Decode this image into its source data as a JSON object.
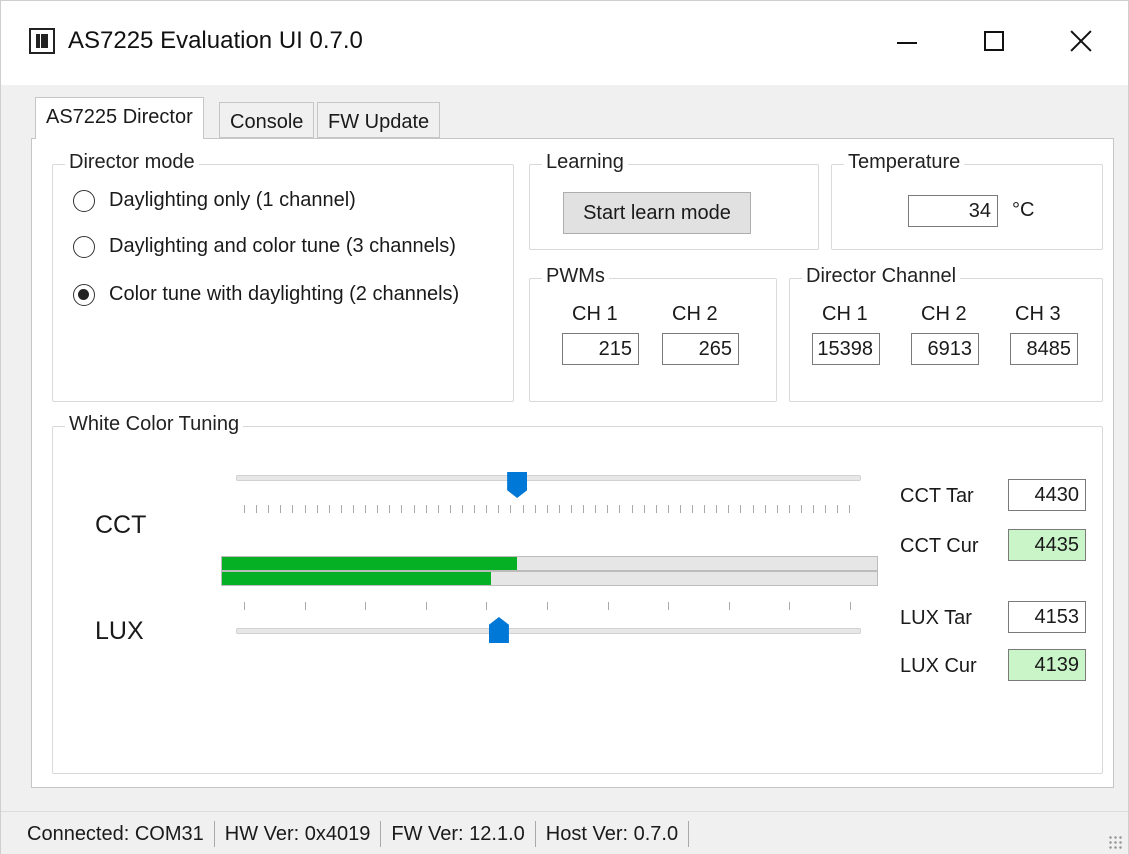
{
  "window": {
    "title": "AS7225 Evaluation UI 0.7.0"
  },
  "tabs": [
    {
      "label": "AS7225 Director",
      "active": true
    },
    {
      "label": "Console",
      "active": false
    },
    {
      "label": "FW Update",
      "active": false
    }
  ],
  "director_mode": {
    "title": "Director mode",
    "options": [
      {
        "label": "Daylighting only (1 channel)",
        "checked": false
      },
      {
        "label": "Daylighting and color tune (3 channels)",
        "checked": false
      },
      {
        "label": "Color tune with daylighting (2 channels)",
        "checked": true
      }
    ]
  },
  "learning": {
    "title": "Learning",
    "button_label": "Start learn mode"
  },
  "temperature": {
    "title": "Temperature",
    "value": "34",
    "unit": "°C"
  },
  "pwms": {
    "title": "PWMs",
    "channels": [
      {
        "label": "CH 1",
        "value": "215"
      },
      {
        "label": "CH 2",
        "value": "265"
      }
    ]
  },
  "director_channel": {
    "title": "Director Channel",
    "channels": [
      {
        "label": "CH 1",
        "value": "15398"
      },
      {
        "label": "CH 2",
        "value": "6913"
      },
      {
        "label": "CH 3",
        "value": "8485"
      }
    ]
  },
  "white_color_tuning": {
    "title": "White Color Tuning",
    "cct": {
      "label": "CCT",
      "slider_fraction": 0.45,
      "progress_fraction": 0.45
    },
    "lux": {
      "label": "LUX",
      "slider_fraction": 0.42,
      "progress_fraction": 0.41
    },
    "readouts": {
      "cct_tar_label": "CCT Tar",
      "cct_tar_value": "4430",
      "cct_cur_label": "CCT Cur",
      "cct_cur_value": "4435",
      "lux_tar_label": "LUX Tar",
      "lux_tar_value": "4153",
      "lux_cur_label": "LUX Cur",
      "lux_cur_value": "4139"
    },
    "colors": {
      "progress": "#06b025",
      "current_bg": "#c9f5c9",
      "thumb": "#0078d7"
    }
  },
  "status_bar": {
    "connection": "Connected: COM31",
    "hw_version": "HW Ver: 0x4019",
    "fw_version": "FW Ver: 12.1.0",
    "host_version": "Host Ver: 0.7.0"
  }
}
